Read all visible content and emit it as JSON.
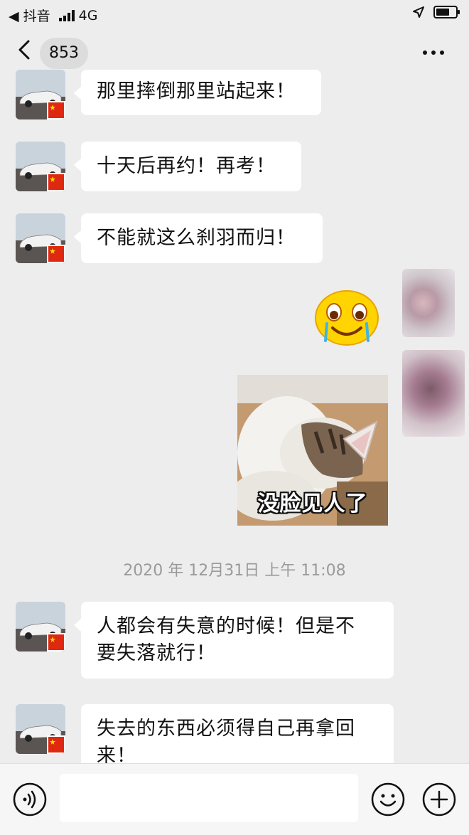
{
  "status_bar": {
    "back_app": "◀ 抖音",
    "network": "4G"
  },
  "nav": {
    "unread_count": "853"
  },
  "messages": [
    {
      "text": "那里摔倒那里站起来！"
    },
    {
      "text": "十天后再约！再考！"
    },
    {
      "text": "不能就这么刹羽而归！"
    },
    {
      "text_line1": "人都会有失意的时候！但是不",
      "text_line2": "要失落就行！"
    },
    {
      "text_line1": "失去的东西必须得自己再拿回",
      "text_line2": "来！"
    }
  ],
  "timestamp": "2020 年 12月31日 上午 11:08",
  "sticker": {
    "caption": "没脸见人了"
  },
  "emoji": {
    "icon": "crying-laughing-emoji"
  },
  "colors": {
    "background": "#ededed",
    "bubble": "#ffffff",
    "timestamp": "#9a9a9a",
    "flag_red": "#de2910",
    "flag_yellow": "#ffde00"
  }
}
